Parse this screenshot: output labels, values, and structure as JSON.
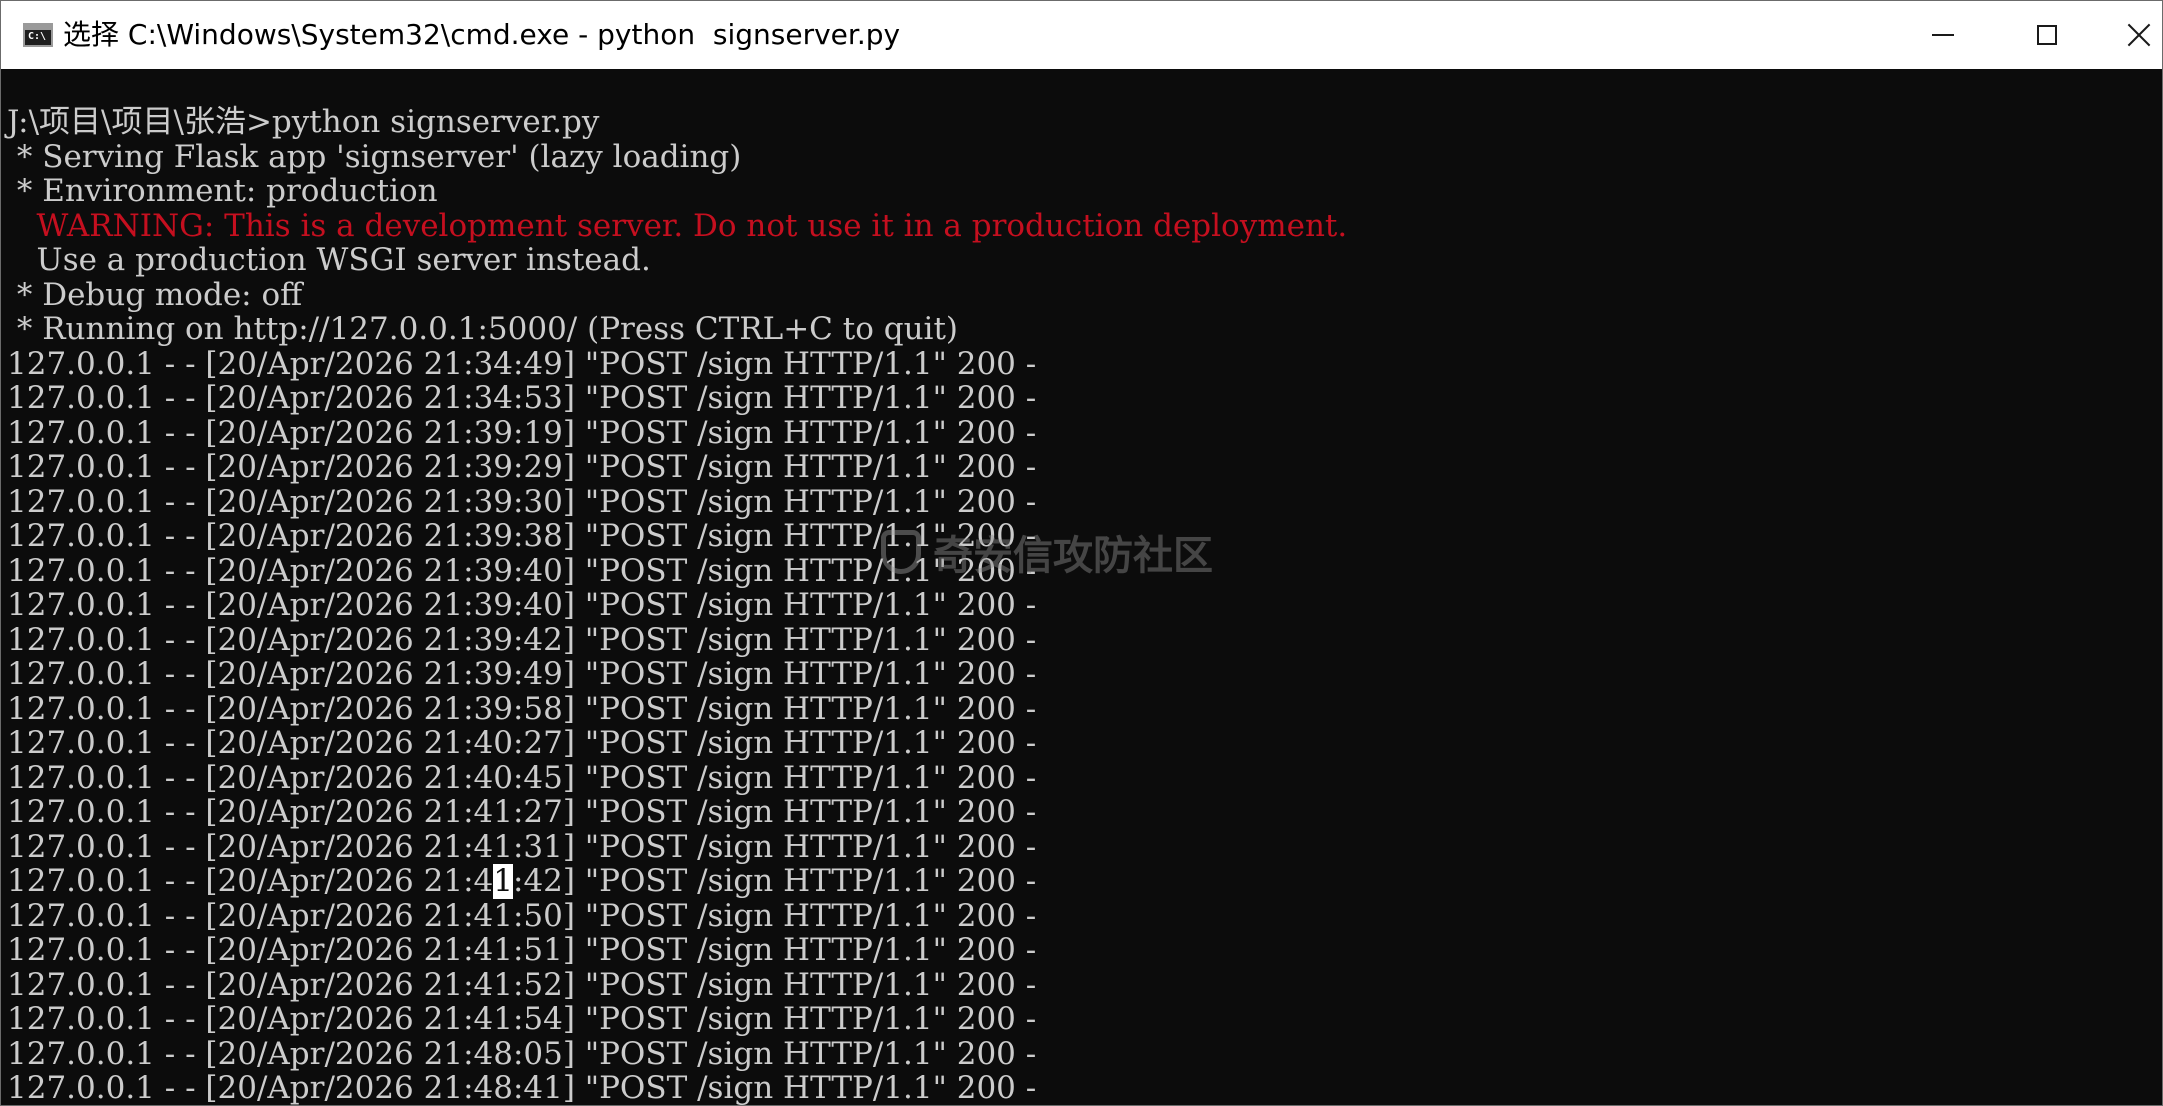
{
  "window": {
    "title": "选择 C:\\Windows\\System32\\cmd.exe - python  signserver.py",
    "icon": "cmd-icon",
    "icon_glyph": "C:\\",
    "controls": {
      "minimize": "minimize-icon",
      "maximize": "maximize-icon",
      "close": "close-icon"
    }
  },
  "console": {
    "prompt_line": "J:\\项目\\项目\\张浩>python signserver.py",
    "startup": [
      " * Serving Flask app 'signserver' (lazy loading)",
      " * Environment: production"
    ],
    "warning": "   WARNING: This is a development server. Do not use it in a production deployment.",
    "after_warning": [
      "   Use a production WSGI server instead.",
      " * Debug mode: off",
      " * Running on http://127.0.0.1:5000/ (Press CTRL+C to quit)"
    ],
    "log_lines": [
      "127.0.0.1 - - [20/Apr/2026 21:34:49] \"POST /sign HTTP/1.1\" 200 -",
      "127.0.0.1 - - [20/Apr/2026 21:34:53] \"POST /sign HTTP/1.1\" 200 -",
      "127.0.0.1 - - [20/Apr/2026 21:39:19] \"POST /sign HTTP/1.1\" 200 -",
      "127.0.0.1 - - [20/Apr/2026 21:39:29] \"POST /sign HTTP/1.1\" 200 -",
      "127.0.0.1 - - [20/Apr/2026 21:39:30] \"POST /sign HTTP/1.1\" 200 -",
      "127.0.0.1 - - [20/Apr/2026 21:39:38] \"POST /sign HTTP/1.1\" 200 -",
      "127.0.0.1 - - [20/Apr/2026 21:39:40] \"POST /sign HTTP/1.1\" 200 -",
      "127.0.0.1 - - [20/Apr/2026 21:39:40] \"POST /sign HTTP/1.1\" 200 -",
      "127.0.0.1 - - [20/Apr/2026 21:39:42] \"POST /sign HTTP/1.1\" 200 -",
      "127.0.0.1 - - [20/Apr/2026 21:39:49] \"POST /sign HTTP/1.1\" 200 -",
      "127.0.0.1 - - [20/Apr/2026 21:39:58] \"POST /sign HTTP/1.1\" 200 -",
      "127.0.0.1 - - [20/Apr/2026 21:40:27] \"POST /sign HTTP/1.1\" 200 -",
      "127.0.0.1 - - [20/Apr/2026 21:40:45] \"POST /sign HTTP/1.1\" 200 -",
      "127.0.0.1 - - [20/Apr/2026 21:41:27] \"POST /sign HTTP/1.1\" 200 -",
      "127.0.0.1 - - [20/Apr/2026 21:41:31] \"POST /sign HTTP/1.1\" 200 -"
    ],
    "selected_line": {
      "before": "127.0.0.1 - - [20/Apr/2026 21:4",
      "highlight": "1",
      "after": ":42] \"POST /sign HTTP/1.1\" 200 -"
    },
    "log_lines_after": [
      "127.0.0.1 - - [20/Apr/2026 21:41:50] \"POST /sign HTTP/1.1\" 200 -",
      "127.0.0.1 - - [20/Apr/2026 21:41:51] \"POST /sign HTTP/1.1\" 200 -",
      "127.0.0.1 - - [20/Apr/2026 21:41:52] \"POST /sign HTTP/1.1\" 200 -",
      "127.0.0.1 - - [20/Apr/2026 21:41:54] \"POST /sign HTTP/1.1\" 200 -",
      "127.0.0.1 - - [20/Apr/2026 21:48:05] \"POST /sign HTTP/1.1\" 200 -",
      "127.0.0.1 - - [20/Apr/2026 21:48:41] \"POST /sign HTTP/1.1\" 200 -"
    ]
  },
  "watermark": {
    "text": "奇安信攻防社区",
    "icon": "shield-logo-icon"
  },
  "colors": {
    "background": "#0c0c0c",
    "foreground": "#cccccc",
    "warning": "#c50f1f",
    "titlebar": "#ffffff"
  }
}
